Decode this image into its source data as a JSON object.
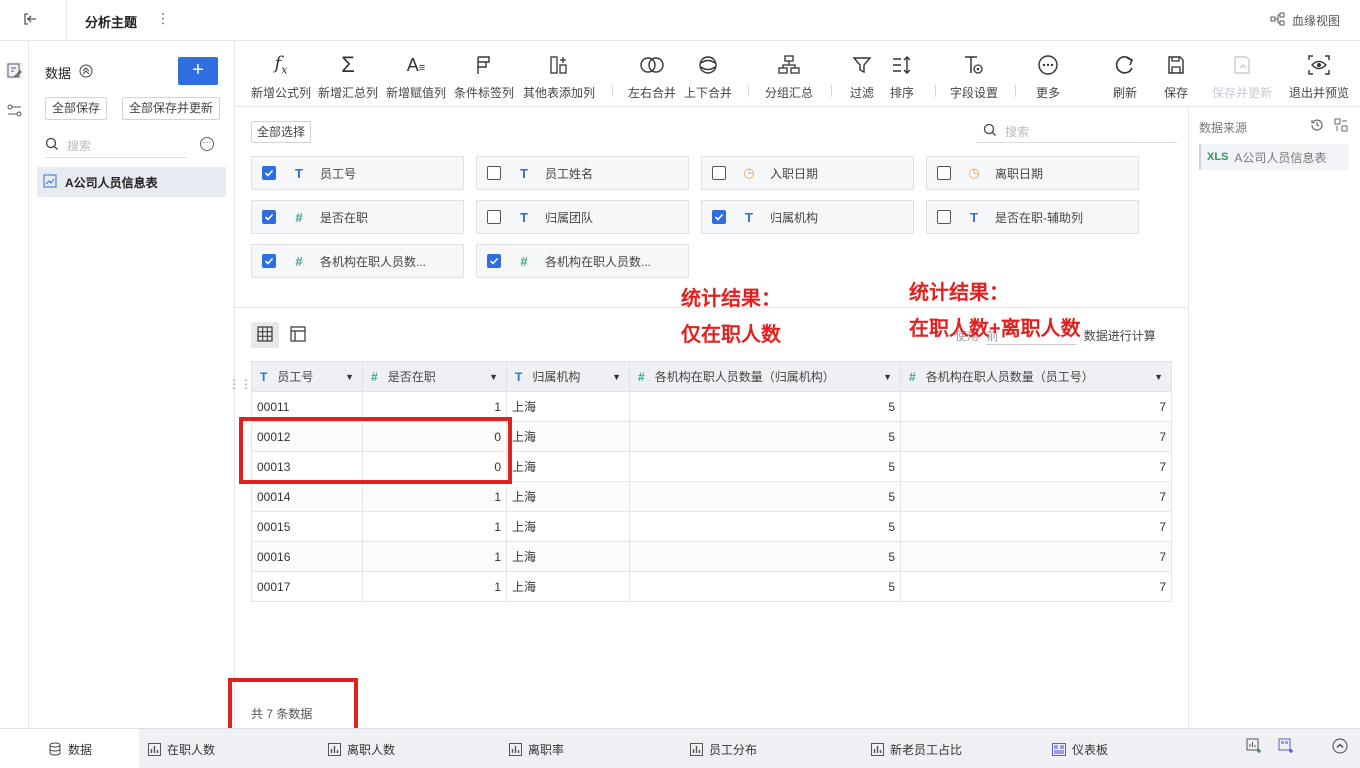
{
  "topbar": {
    "title": "分析主题",
    "lineage_label": "血缘视图"
  },
  "data_panel": {
    "title": "数据",
    "save_all": "全部保存",
    "save_all_update": "全部保存并更新",
    "search_placeholder": "搜索",
    "table_item": "A公司人员信息表"
  },
  "toolbar": {
    "items": [
      {
        "label": "新增公式列",
        "icon": "formula-icon"
      },
      {
        "label": "新增汇总列",
        "icon": "sigma-icon"
      },
      {
        "label": "新增赋值列",
        "icon": "assign-icon"
      },
      {
        "label": "条件标签列",
        "icon": "flag-icon"
      },
      {
        "label": "其他表添加列",
        "icon": "add-column-icon"
      },
      {
        "label": "左右合并",
        "icon": "left-right-merge-icon"
      },
      {
        "label": "上下合并",
        "icon": "up-down-merge-icon"
      },
      {
        "label": "分组汇总",
        "icon": "group-summary-icon"
      },
      {
        "label": "过滤",
        "icon": "filter-icon"
      },
      {
        "label": "排序",
        "icon": "sort-icon"
      },
      {
        "label": "字段设置",
        "icon": "field-settings-icon"
      },
      {
        "label": "更多",
        "icon": "more-icon"
      },
      {
        "label": "刷新",
        "icon": "refresh-icon"
      },
      {
        "label": "保存",
        "icon": "save-icon"
      },
      {
        "label": "保存并更新",
        "icon": "save-update-icon"
      },
      {
        "label": "退出并预览",
        "icon": "preview-icon"
      }
    ]
  },
  "fields": {
    "select_all": "全部选择",
    "search_placeholder": "搜索",
    "items": [
      {
        "name": "员工号",
        "type": "text",
        "checked": true
      },
      {
        "name": "员工姓名",
        "type": "text",
        "checked": false
      },
      {
        "name": "入职日期",
        "type": "date",
        "checked": false
      },
      {
        "name": "离职日期",
        "type": "date",
        "checked": false
      },
      {
        "name": "是否在职",
        "type": "number",
        "checked": true
      },
      {
        "name": "归属团队",
        "type": "text",
        "checked": false
      },
      {
        "name": "归属机构",
        "type": "text",
        "checked": true
      },
      {
        "name": "是否在职-辅助列",
        "type": "text",
        "checked": false
      },
      {
        "name": "各机构在职人员数...",
        "type": "number",
        "checked": true
      },
      {
        "name": "各机构在职人员数...",
        "type": "number",
        "checked": true
      }
    ]
  },
  "preview": {
    "calc_note_prefix": "使用",
    "calc_note_mid": "前",
    "calc_note_suffix": "数据进行计算",
    "columns": [
      {
        "label": "员工号",
        "type": "text"
      },
      {
        "label": "是否在职",
        "type": "number"
      },
      {
        "label": "归属机构",
        "type": "text"
      },
      {
        "label": "各机构在职人员数量（归属机构）",
        "type": "number"
      },
      {
        "label": "各机构在职人员数量（员工号）",
        "type": "number"
      }
    ],
    "rows": [
      [
        "00011",
        "1",
        "上海",
        "5",
        "7"
      ],
      [
        "00012",
        "0",
        "上海",
        "5",
        "7"
      ],
      [
        "00013",
        "0",
        "上海",
        "5",
        "7"
      ],
      [
        "00014",
        "1",
        "上海",
        "5",
        "7"
      ],
      [
        "00015",
        "1",
        "上海",
        "5",
        "7"
      ],
      [
        "00016",
        "1",
        "上海",
        "5",
        "7"
      ],
      [
        "00017",
        "1",
        "上海",
        "5",
        "7"
      ]
    ],
    "total": "共 7 条数据"
  },
  "annotations": {
    "left": [
      "统计结果：",
      "仅在职人数"
    ],
    "right": [
      "统计结果：",
      "在职人数+离职人数"
    ]
  },
  "source": {
    "title": "数据来源",
    "item": "A公司人员信息表",
    "xls": "XLS"
  },
  "bottom_tabs": [
    {
      "label": "数据",
      "active": true
    },
    {
      "label": "在职人数"
    },
    {
      "label": "离职人数"
    },
    {
      "label": "离职率"
    },
    {
      "label": "员工分布"
    },
    {
      "label": "新老员工占比"
    },
    {
      "label": "仪表板"
    }
  ],
  "colors": {
    "accent": "#2f6ee0",
    "annotation": "#e0211f",
    "number_type": "#3aa58d",
    "date_type": "#f0a04b"
  }
}
